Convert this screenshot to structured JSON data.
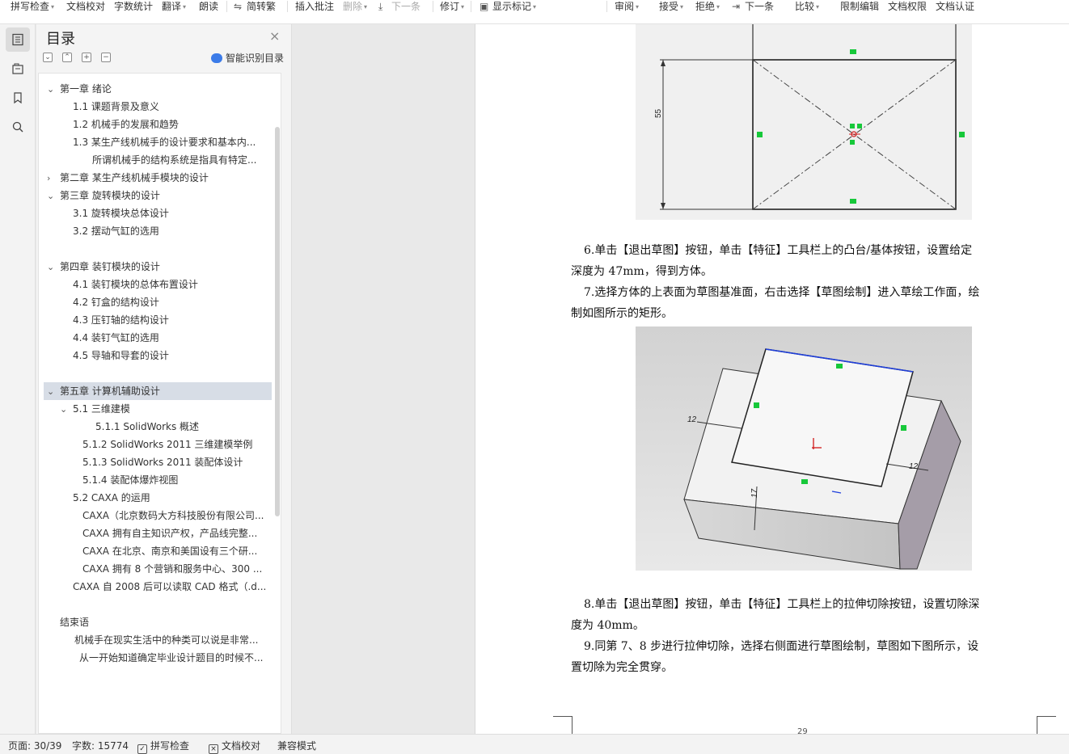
{
  "toolbar": {
    "items": [
      {
        "label": "拼写检查",
        "dropdown": true,
        "disabled": false,
        "icon": ""
      },
      {
        "label": "文档校对",
        "dropdown": false,
        "disabled": false,
        "icon": ""
      },
      {
        "label": "字数统计",
        "dropdown": false,
        "disabled": false,
        "icon": ""
      },
      {
        "label": "翻译",
        "dropdown": true,
        "disabled": false,
        "icon": ""
      },
      {
        "label": "朗读",
        "dropdown": false,
        "disabled": false,
        "icon": ""
      },
      {
        "label": "简转繁",
        "dropdown": false,
        "disabled": false,
        "icon": "convert-icon"
      },
      {
        "label": "插入批注",
        "dropdown": false,
        "disabled": false,
        "icon": ""
      },
      {
        "label": "删除",
        "dropdown": true,
        "disabled": true,
        "icon": ""
      },
      {
        "label": "下一条",
        "dropdown": false,
        "disabled": true,
        "icon": "next-comment-icon"
      },
      {
        "label": "修订",
        "dropdown": true,
        "disabled": false,
        "icon": ""
      },
      {
        "label": "显示标记",
        "dropdown": true,
        "disabled": false,
        "icon": "show-markup-icon"
      },
      {
        "label": "审阅",
        "dropdown": true,
        "disabled": false,
        "icon": ""
      },
      {
        "label": "接受",
        "dropdown": true,
        "disabled": false,
        "icon": ""
      },
      {
        "label": "拒绝",
        "dropdown": true,
        "disabled": false,
        "icon": ""
      },
      {
        "label": "下一条",
        "dropdown": false,
        "disabled": false,
        "icon": "next-change-icon"
      },
      {
        "label": "比较",
        "dropdown": true,
        "disabled": false,
        "icon": ""
      },
      {
        "label": "限制编辑",
        "dropdown": false,
        "disabled": false,
        "icon": ""
      },
      {
        "label": "文档权限",
        "dropdown": false,
        "disabled": false,
        "icon": ""
      },
      {
        "label": "文档认证",
        "dropdown": false,
        "disabled": false,
        "icon": ""
      }
    ]
  },
  "sidebar_icons": [
    "toc-icon",
    "outline-icon",
    "bookmark-icon",
    "search-icon"
  ],
  "toc": {
    "title": "目录",
    "close": "×",
    "smart_label": "智能识别目录",
    "tool_glyphs": [
      "⌄",
      "⌃",
      "+",
      "−"
    ],
    "items": [
      {
        "text": "第一章  绪论",
        "arrow": "⌄"
      },
      {
        "text": "1.1  课题背景及意义",
        "arrow": ""
      },
      {
        "text": "1.2  机械手的发展和趋势",
        "arrow": ""
      },
      {
        "text": "1.3  某生产线机械手的设计要求和基本内...",
        "arrow": ""
      },
      {
        "text": "所谓机械手的结构系统是指具有特定...",
        "arrow": ""
      },
      {
        "text": "第二章    某生产线机械手模块的设计",
        "arrow": "›"
      },
      {
        "text": "第三章  旋转模块的设计",
        "arrow": "⌄"
      },
      {
        "text": "3.1 旋转模块总体设计",
        "arrow": ""
      },
      {
        "text": "3.2 摆动气缸的选用",
        "arrow": ""
      },
      {
        "text": "第四章  装钉模块的设计",
        "arrow": "⌄"
      },
      {
        "text": "4.1  装钉模块的总体布置设计",
        "arrow": ""
      },
      {
        "text": "4.2 钉盒的结构设计",
        "arrow": ""
      },
      {
        "text": "4.3 压钉轴的结构设计",
        "arrow": ""
      },
      {
        "text": "4.4 装钉气缸的选用",
        "arrow": ""
      },
      {
        "text": "4.5 导轴和导套的设计",
        "arrow": ""
      },
      {
        "text": "第五章  计算机辅助设计",
        "arrow": "⌄"
      },
      {
        "text": "5.1  三维建模",
        "arrow": "⌄"
      },
      {
        "text": "5.1.1 SolidWorks 概述",
        "arrow": ""
      },
      {
        "text": "5.1.2 SolidWorks 2011 三维建模举例",
        "arrow": ""
      },
      {
        "text": "5.1.3 SolidWorks     2011 装配体设计",
        "arrow": ""
      },
      {
        "text": "5.1.4 装配体爆炸视图",
        "arrow": ""
      },
      {
        "text": "5.2 CAXA 的运用",
        "arrow": ""
      },
      {
        "text": "CAXA（北京数码大方科技股份有限公司...",
        "arrow": ""
      },
      {
        "text": "CAXA 拥有自主知识产权，产品线完整...",
        "arrow": ""
      },
      {
        "text": "CAXA 在北京、南京和美国设有三个研...",
        "arrow": ""
      },
      {
        "text": "CAXA 拥有 8 个营销和服务中心、300 ...",
        "arrow": ""
      },
      {
        "text": "CAXA 自 2008 后可以读取 CAD 格式（.d...",
        "arrow": ""
      },
      {
        "text": "结束语",
        "arrow": ""
      },
      {
        "text": "机械手在现实生活中的种类可以说是非常...",
        "arrow": ""
      },
      {
        "text": "从一开始知道确定毕业设计题目的时候不...",
        "arrow": ""
      }
    ]
  },
  "document": {
    "fig1_dimension": "55",
    "fig2_dimensions": [
      "12",
      "12",
      "17"
    ],
    "paragraphs": [
      "6.单击【退出草图】按钮，单击【特征】工具栏上的凸台/基体按钮，设置给定",
      "深度为 47mm，得到方体。",
      "7.选择方体的上表面为草图基准面，右击选择【草图绘制】进入草绘工作面，绘",
      "制如图所示的矩形。",
      "8.单击【退出草图】按钮，单击【特征】工具栏上的拉伸切除按钮，设置切除深",
      "度为 40mm。",
      "9.同第 7、8 步进行拉伸切除，选择右侧面进行草图绘制，草图如下图所示，设",
      "置切除为完全贯穿。"
    ],
    "page_number": "29"
  },
  "status": {
    "page": "页面: 30/39",
    "words": "字数: 15774",
    "spell": "拼写检查",
    "proof": "文档校对",
    "mode": "兼容模式"
  },
  "colors": {
    "accent": "#3b7be8",
    "selected_row": "#d7dde6",
    "sketch_blue": "#1f3fdc",
    "constraint_green": "#17c83a"
  }
}
